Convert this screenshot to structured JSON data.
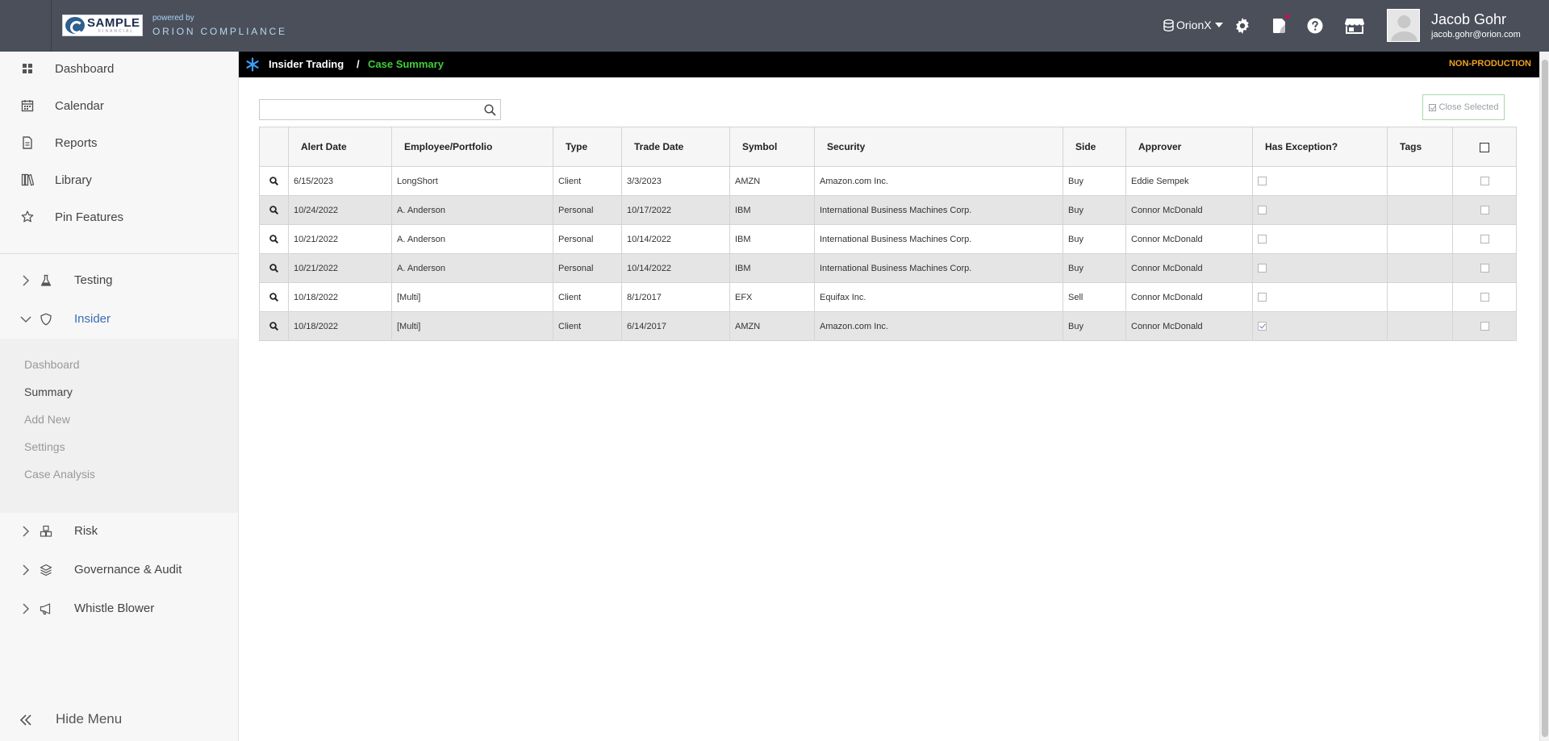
{
  "header": {
    "logo_big": "SAMPLE",
    "logo_small": "FINANCIAL",
    "powered_by": "powered by",
    "brand": "ORION COMPLIANCE",
    "database": "OrionX",
    "user_name": "Jacob Gohr",
    "user_email": "jacob.gohr@orion.com",
    "icons": [
      "database-icon",
      "caret-down-icon",
      "gear-icon",
      "notes-icon",
      "help-icon",
      "store-icon",
      "avatar"
    ]
  },
  "sidebar": {
    "items": [
      {
        "label": "Dashboard",
        "icon": "grid-icon"
      },
      {
        "label": "Calendar",
        "icon": "calendar-icon"
      },
      {
        "label": "Reports",
        "icon": "document-icon"
      },
      {
        "label": "Library",
        "icon": "library-icon"
      },
      {
        "label": "Pin Features",
        "icon": "star-icon"
      }
    ],
    "groups": [
      {
        "label": "Testing",
        "icon": "flask-icon",
        "expanded": false
      },
      {
        "label": "Insider",
        "icon": "shield-icon",
        "expanded": true
      },
      {
        "label": "Risk",
        "icon": "cubes-icon",
        "expanded": false
      },
      {
        "label": "Governance & Audit",
        "icon": "layers-icon",
        "expanded": false
      },
      {
        "label": "Whistle Blower",
        "icon": "megaphone-icon",
        "expanded": false
      }
    ],
    "insider_sub": [
      "Dashboard",
      "Summary",
      "Add New",
      "Settings",
      "Case Analysis"
    ],
    "active_sub": "Summary",
    "hide_menu": "Hide Menu"
  },
  "breadcrumb": {
    "root": "Insider Trading",
    "separator": "/",
    "current": "Case Summary",
    "environment": "NON-PRODUCTION"
  },
  "search": {
    "value": "",
    "placeholder": ""
  },
  "close_selected": "Close Selected",
  "table": {
    "columns": [
      "Alert Date",
      "Employee/Portfolio",
      "Type",
      "Trade Date",
      "Symbol",
      "Security",
      "Side",
      "Approver",
      "Has Exception?",
      "Tags"
    ],
    "rows": [
      {
        "alert_date": "6/15/2023",
        "employee": "LongShort",
        "type": "Client",
        "trade_date": "3/3/2023",
        "symbol": "AMZN",
        "security": "Amazon.com Inc.",
        "side": "Buy",
        "approver": "Eddie Sempek",
        "has_exception": false,
        "tags": "",
        "selected": false
      },
      {
        "alert_date": "10/24/2022",
        "employee": "A. Anderson",
        "type": "Personal",
        "trade_date": "10/17/2022",
        "symbol": "IBM",
        "security": "International Business Machines Corp.",
        "side": "Buy",
        "approver": "Connor McDonald",
        "has_exception": false,
        "tags": "",
        "selected": false
      },
      {
        "alert_date": "10/21/2022",
        "employee": "A. Anderson",
        "type": "Personal",
        "trade_date": "10/14/2022",
        "symbol": "IBM",
        "security": "International Business Machines Corp.",
        "side": "Buy",
        "approver": "Connor McDonald",
        "has_exception": false,
        "tags": "",
        "selected": false
      },
      {
        "alert_date": "10/21/2022",
        "employee": "A. Anderson",
        "type": "Personal",
        "trade_date": "10/14/2022",
        "symbol": "IBM",
        "security": "International Business Machines Corp.",
        "side": "Buy",
        "approver": "Connor McDonald",
        "has_exception": false,
        "tags": "",
        "selected": false
      },
      {
        "alert_date": "10/18/2022",
        "employee": "[Multi]",
        "type": "Client",
        "trade_date": "8/1/2017",
        "symbol": "EFX",
        "security": "Equifax Inc.",
        "side": "Sell",
        "approver": "Connor McDonald",
        "has_exception": false,
        "tags": "",
        "selected": false
      },
      {
        "alert_date": "10/18/2022",
        "employee": "[Multi]",
        "type": "Client",
        "trade_date": "6/14/2017",
        "symbol": "AMZN",
        "security": "Amazon.com Inc.",
        "side": "Buy",
        "approver": "Connor McDonald",
        "has_exception": true,
        "tags": "",
        "selected": false
      }
    ]
  },
  "colors": {
    "header_bg": "#4a4f5a",
    "breadcrumb_bg": "#000000",
    "breadcrumb_current": "#3fcf39",
    "environment_badge": "#f0a020",
    "sidebar_bg": "#f7f7f7",
    "row_alt": "#e5e5e5"
  }
}
